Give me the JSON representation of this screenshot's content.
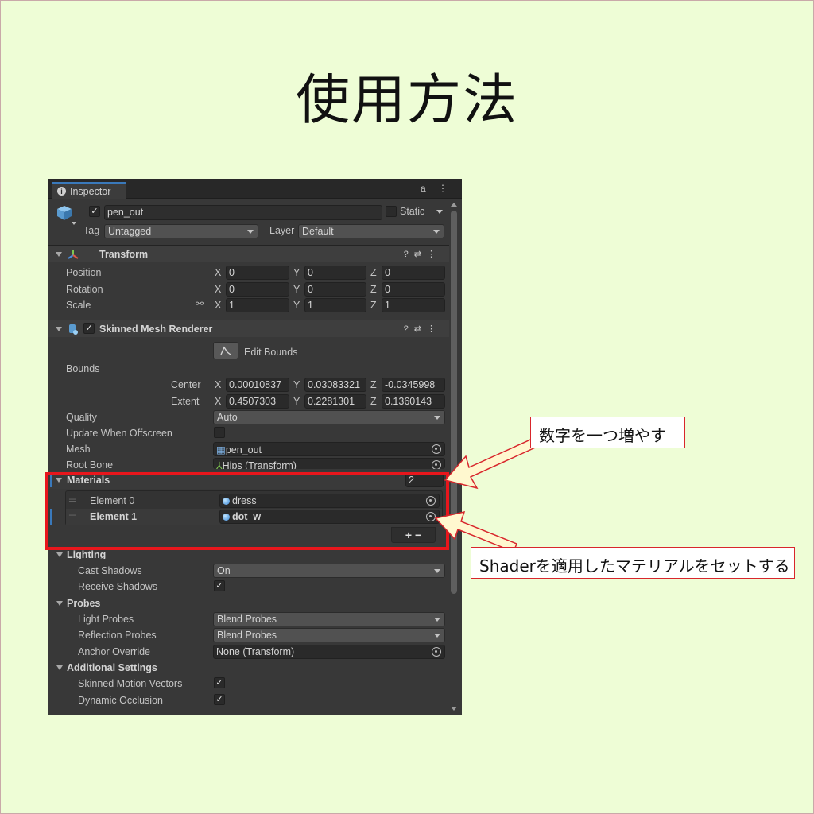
{
  "slide": {
    "title": "使用方法"
  },
  "inspector": {
    "tab_label": "Inspector",
    "tab_actions": "a ⋮",
    "object": {
      "name": "pen_out",
      "static_label": "Static",
      "tag_label": "Tag",
      "tag_value": "Untagged",
      "layer_label": "Layer",
      "layer_value": "Default"
    },
    "transform": {
      "title": "Transform",
      "rows": [
        {
          "label": "Position",
          "x": "0",
          "y": "0",
          "z": "0"
        },
        {
          "label": "Rotation",
          "x": "0",
          "y": "0",
          "z": "0"
        },
        {
          "label": "Scale",
          "x": "1",
          "y": "1",
          "z": "1"
        }
      ]
    },
    "skinned_mesh_renderer": {
      "title": "Skinned Mesh Renderer",
      "edit_bounds_label": "Edit Bounds",
      "bounds_label": "Bounds",
      "center": {
        "label": "Center",
        "x": "0.00010837",
        "y": "0.03083321",
        "z": "-0.0345998"
      },
      "extent": {
        "label": "Extent",
        "x": "0.4507303",
        "y": "0.2281301",
        "z": "0.1360143"
      },
      "quality_label": "Quality",
      "quality_value": "Auto",
      "update_offscreen_label": "Update When Offscreen",
      "mesh_label": "Mesh",
      "mesh_value": "pen_out",
      "root_bone_label": "Root Bone",
      "root_bone_value": "Hips (Transform)",
      "materials_label": "Materials",
      "materials_count": "2",
      "materials": [
        {
          "label": "Element 0",
          "value": "dress"
        },
        {
          "label": "Element 1",
          "value": "dot_w"
        }
      ],
      "add_remove": "+   −",
      "lighting_label": "Lighting",
      "cast_shadows_label": "Cast Shadows",
      "cast_shadows_value": "On",
      "receive_shadows_label": "Receive Shadows",
      "probes_label": "Probes",
      "light_probes_label": "Light Probes",
      "light_probes_value": "Blend Probes",
      "reflection_probes_label": "Reflection Probes",
      "reflection_probes_value": "Blend Probes",
      "anchor_override_label": "Anchor Override",
      "anchor_override_value": "None (Transform)",
      "additional_settings_label": "Additional Settings",
      "skinned_motion_vectors_label": "Skinned Motion Vectors",
      "dynamic_occlusion_label": "Dynamic Occlusion"
    },
    "axis": {
      "x": "X",
      "y": "Y",
      "z": "Z"
    },
    "check_mark": "✓"
  },
  "callouts": {
    "increment_number": "数字を一つ増やす",
    "set_material": "Shaderを適用したマテリアルをセットする"
  },
  "colors": {
    "background": "#eefdd6",
    "callout_border": "#d8262c",
    "highlight": "#e8161c",
    "panel": "#383838"
  }
}
